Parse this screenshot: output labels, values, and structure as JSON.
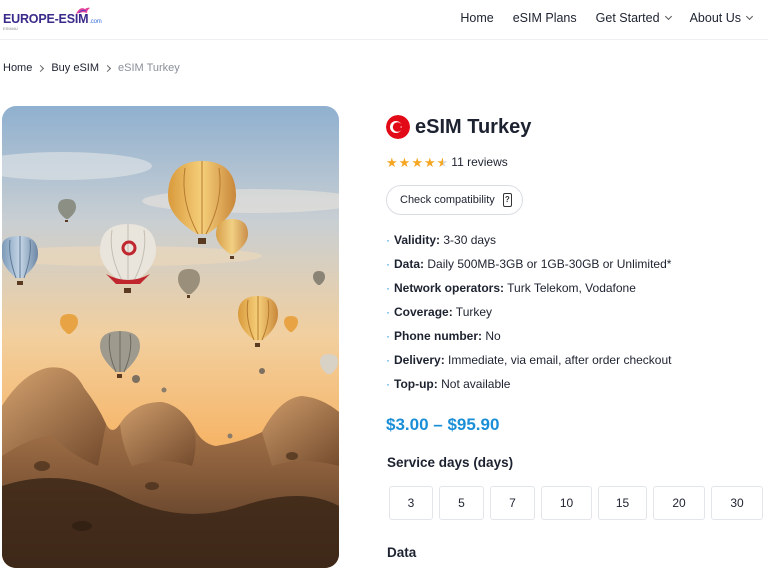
{
  "header": {
    "logo_text": "EUROPE-ESIM",
    "logo_dotcom": ".com",
    "logo_sub": "ESIM4U",
    "nav": [
      {
        "label": "Home",
        "has_dropdown": false
      },
      {
        "label": "eSIM Plans",
        "has_dropdown": false
      },
      {
        "label": "Get Started",
        "has_dropdown": true
      },
      {
        "label": "About Us",
        "has_dropdown": true
      }
    ]
  },
  "breadcrumb": {
    "items": [
      "Home",
      "Buy eSIM"
    ],
    "current": "eSIM Turkey"
  },
  "product": {
    "title": "eSIM Turkey",
    "flag_icon": "turkey-flag-icon",
    "rating": 4.5,
    "reviews": "11 reviews",
    "compat_button": "Check compatibility",
    "specs": [
      {
        "key": "Validity:",
        "value": " 3-30 days"
      },
      {
        "key": "Data:",
        "value": " Daily 500MB-3GB or 1GB-30GB or Unlimited*"
      },
      {
        "key": "Network operators:",
        "value": " Turk Telekom, Vodafone"
      },
      {
        "key": "Coverage:",
        "value": " Turkey"
      },
      {
        "key": "Phone number:",
        "value": " No"
      },
      {
        "key": "Delivery:",
        "value": " Immediate, via email, after order checkout"
      },
      {
        "key": "Top-up:",
        "value": " Not available"
      }
    ],
    "price": "$3.00 – $95.90",
    "service_days_label": "Service days (days)",
    "service_days": [
      "3",
      "5",
      "7",
      "10",
      "15",
      "20",
      "30"
    ],
    "data_label": "Data"
  },
  "colors": {
    "accent": "#1a8fd8",
    "star": "#f5a623",
    "text": "#1d2230",
    "muted": "#8a8f98"
  }
}
